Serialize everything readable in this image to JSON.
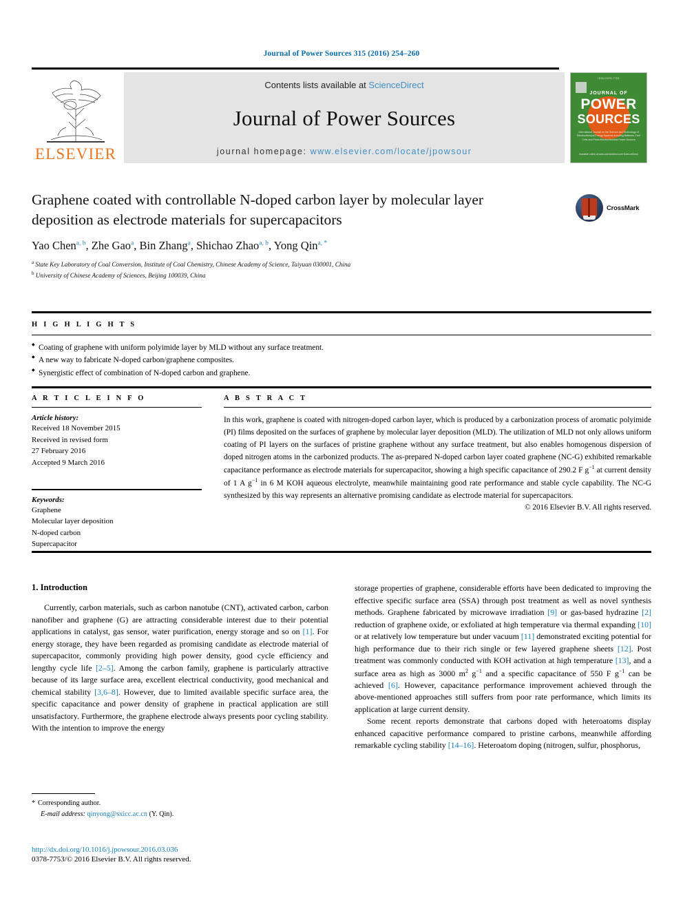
{
  "running_head": "Journal of Power Sources 315 (2016) 254–260",
  "masthead": {
    "contents_prefix": "Contents lists available at ",
    "sciencedirect": "ScienceDirect",
    "journal_name": "Journal of Power Sources",
    "homepage_prefix": "journal homepage: ",
    "homepage_url": "www.elsevier.com/locate/jpowsour",
    "publisher_wordmark": "ELSEVIER",
    "cover": {
      "top_text": "ISSN 0378-7753",
      "line1": "JOURNAL OF",
      "line2": "POWER",
      "line3": "SOURCES",
      "subtitle": "International Journal on the Science and Technology of Electrochemical Energy Systems including Batteries, Fuel Cells and Photo-Electrochemical Power Sources",
      "footer": "Available online at www.sciencedirect.com  ScienceDirect"
    },
    "colors": {
      "link": "#3f8fc4",
      "banner_bg": "#e4e4e4",
      "elsevier_orange": "#e87722",
      "cover_green": "#3f8a35",
      "cover_orange": "#e35a16"
    }
  },
  "title_block": {
    "title": "Graphene coated with controllable N-doped carbon layer by molecular layer deposition as electrode materials for supercapacitors",
    "crossmark_label": "CrossMark",
    "authors": [
      {
        "name": "Yao Chen",
        "marks": "a, b"
      },
      {
        "name": "Zhe Gao",
        "marks": "a"
      },
      {
        "name": "Bin Zhang",
        "marks": "a"
      },
      {
        "name": "Shichao Zhao",
        "marks": "a, b"
      },
      {
        "name": "Yong Qin",
        "marks": "a, *"
      }
    ],
    "affiliations": [
      {
        "mark": "a",
        "text": "State Key Laboratory of Coal Conversion, Institute of Coal Chemistry, Chinese Academy of Science, Taiyuan 030001, China"
      },
      {
        "mark": "b",
        "text": "University of Chinese Academy of Sciences, Beijing 100039, China"
      }
    ]
  },
  "highlights": {
    "heading": "H I G H L I G H T S",
    "items": [
      "Coating of graphene with uniform polyimide layer by MLD without any surface treatment.",
      "A new way to fabricate N-doped carbon/graphene composites.",
      "Synergistic effect of combination of N-doped carbon and graphene."
    ]
  },
  "article_info": {
    "heading": "A R T I C L E  I N F O",
    "history_label": "Article history:",
    "history_lines": [
      "Received 18 November 2015",
      "Received in revised form",
      "27 February 2016",
      "Accepted 9 March 2016"
    ],
    "keywords_label": "Keywords:",
    "keywords": [
      "Graphene",
      "Molecular layer deposition",
      "N-doped carbon",
      "Supercapacitor"
    ]
  },
  "abstract": {
    "heading": "A B S T R A C T",
    "text_part1": "In this work, graphene is coated with nitrogen-doped carbon layer, which is produced by a carbonization process of aromatic polyimide (PI) films deposited on the surfaces of graphene by molecular layer deposition (MLD). The utilization of MLD not only allows uniform coating of PI layers on the surfaces of pristine graphene without any surface treatment, but also enables homogenous dispersion of doped nitrogen atoms in the carbonized products. The as-prepared N-doped carbon layer coated graphene (NC-G) exhibited remarkable capacitance performance as electrode materials for supercapacitor, showing a high specific capacitance of 290.2 F g",
    "sup1": "−1",
    "text_part2": " at current density of 1 A g",
    "sup2": "−1",
    "text_part3": " in 6 M KOH aqueous electrolyte, meanwhile maintaining good rate performance and stable cycle capability. The NC-G synthesized by this way represents an alternative promising candidate as electrode material for supercapacitors.",
    "copyright": "© 2016 Elsevier B.V. All rights reserved."
  },
  "body": {
    "section_number_title": "1. Introduction",
    "left_paragraph": {
      "p1_a": "Currently, carbon materials, such as carbon nanotube (CNT), activated carbon, carbon nanofiber and graphene (G) are attracting considerable interest due to their potential applications in catalyst, gas sensor, water purification, energy storage and so on ",
      "ref1": "[1]",
      "p1_b": ". For energy storage, they have been regarded as promising candidate as electrode material of supercapacitor, commonly providing high power density, good cycle efficiency and lengthy cycle life ",
      "ref2": "[2–5]",
      "p1_c": ". Among the carbon family, graphene is particularly attractive because of its large surface area, excellent electrical conductivity, good mechanical and chemical stability ",
      "ref3": "[3,6–8]",
      "p1_d": ". However, due to limited available specific surface area, the specific capacitance and power density of graphene in practical application are still unsatisfactory. Furthermore, the graphene electrode always presents poor cycling stability. With the intention to improve the energy"
    },
    "right_paragraphs": {
      "p1_a": "storage properties of graphene, considerable efforts have been dedicated to improving the effective specific surface area (SSA) through post treatment as well as novel synthesis methods. Graphene fabricated by microwave irradiation ",
      "ref9": "[9]",
      "p1_b": " or gas-based hydrazine ",
      "ref2": "[2]",
      "p1_c": " reduction of graphene oxide, or exfoliated at high temperature via thermal expanding ",
      "ref10": "[10]",
      "p1_d": " or at relatively low temperature but under vacuum ",
      "ref11": "[11]",
      "p1_e": " demonstrated exciting potential for high performance due to their rich single or few layered graphene sheets ",
      "ref12": "[12]",
      "p1_f": ". Post treatment was commonly conducted with KOH activation at high temperature ",
      "ref13": "[13]",
      "p1_g": ", and a surface area as high as 3000 m",
      "sup_2": "2",
      "p1_h": " g",
      "sup_m1": "−1",
      "p1_i": " and a specific capacitance of 550 F g",
      "sup_m1b": "−1",
      "p1_j": " can be achieved ",
      "ref6": "[6]",
      "p1_k": ". However, capacitance performance improvement achieved through the above-mentioned approaches still suffers from poor rate performance, which limits its application at large current density.",
      "p2_a": "Some recent reports demonstrate that carbons doped with heteroatoms display enhanced capacitive performance compared to pristine carbons, meanwhile affording remarkable cycling stability ",
      "ref14": "[14–16]",
      "p2_b": ". Heteroatom doping (nitrogen, sulfur, phosphorus,"
    }
  },
  "footer": {
    "corresponding_marker": "*",
    "corresponding_label": "Corresponding author.",
    "email_label": "E-mail address:",
    "email": "qinyong@sxicc.ac.cn",
    "email_suffix": "(Y. Qin).",
    "doi": "http://dx.doi.org/10.1016/j.jpowsour.2016.03.036",
    "issn_line": "0378-7753/© 2016 Elsevier B.V. All rights reserved."
  }
}
